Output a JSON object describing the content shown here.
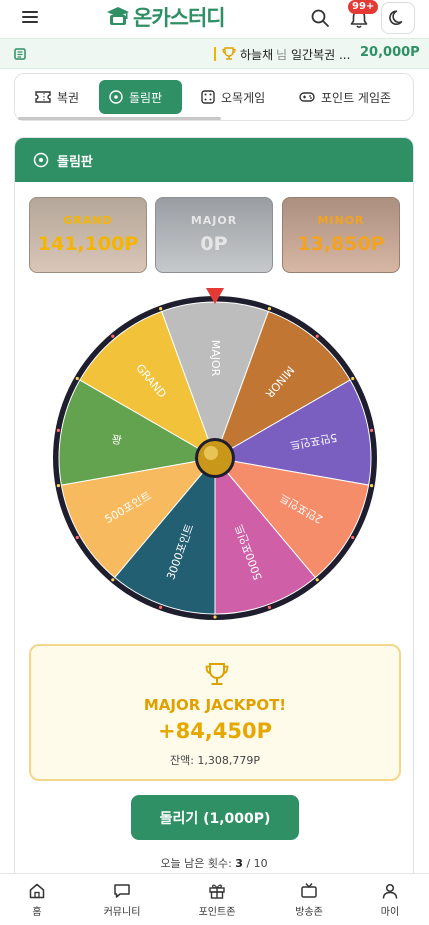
{
  "header": {
    "logo_text": "온카스터디",
    "notification_badge": "99+",
    "icons": [
      "menu-icon",
      "logo-icon",
      "search-icon",
      "bell-icon",
      "moon-icon"
    ]
  },
  "ticker": {
    "winner_name": "하늘채",
    "winner_suffix": "님",
    "game": "일간복권 ...",
    "amount": "20,000P"
  },
  "tabs": [
    {
      "label": "복권",
      "icon": "ticket-icon",
      "active": false
    },
    {
      "label": "돌림판",
      "icon": "target-icon",
      "active": true
    },
    {
      "label": "오목게임",
      "icon": "dice-icon",
      "active": false
    },
    {
      "label": "포인트 게임존",
      "icon": "gamepad-icon",
      "active": false
    }
  ],
  "card": {
    "title": "돌림판"
  },
  "jackpots": [
    {
      "label": "GRAND",
      "value": "141,100P"
    },
    {
      "label": "MAJOR",
      "value": "0P"
    },
    {
      "label": "MINOR",
      "value": "13,850P"
    }
  ],
  "wheel": {
    "segments": [
      {
        "label": "MAJOR",
        "color": "#bdbdbd"
      },
      {
        "label": "MINOR",
        "color": "#c27633"
      },
      {
        "label": "5만포인트",
        "color": "#7b5fc0"
      },
      {
        "label": "2만포인트",
        "color": "#f58c6a"
      },
      {
        "label": "5000포인트",
        "color": "#cf5fa6"
      },
      {
        "label": "3000포인트",
        "color": "#235f73"
      },
      {
        "label": "500포인트",
        "color": "#f8ba5f"
      },
      {
        "label": "꽝",
        "color": "#63a34f"
      },
      {
        "label": "GRAND",
        "color": "#f2c23a"
      }
    ],
    "rim_color": "#1e1e2e",
    "pointer_color": "#e53935"
  },
  "result": {
    "title": "MAJOR JACKPOT!",
    "amount": "+84,450P",
    "balance": "잔액: 1,308,779P"
  },
  "spin_button": "돌리기 (1,000P)",
  "remaining": {
    "label": "오늘 남은 횟수:",
    "used": "3",
    "total": "/ 10"
  },
  "bottom_nav": [
    {
      "label": "홈",
      "icon": "home-icon"
    },
    {
      "label": "커뮤니티",
      "icon": "chat-icon"
    },
    {
      "label": "포인트존",
      "icon": "gift-icon"
    },
    {
      "label": "방송존",
      "icon": "tv-icon"
    },
    {
      "label": "마이",
      "icon": "user-icon"
    }
  ]
}
